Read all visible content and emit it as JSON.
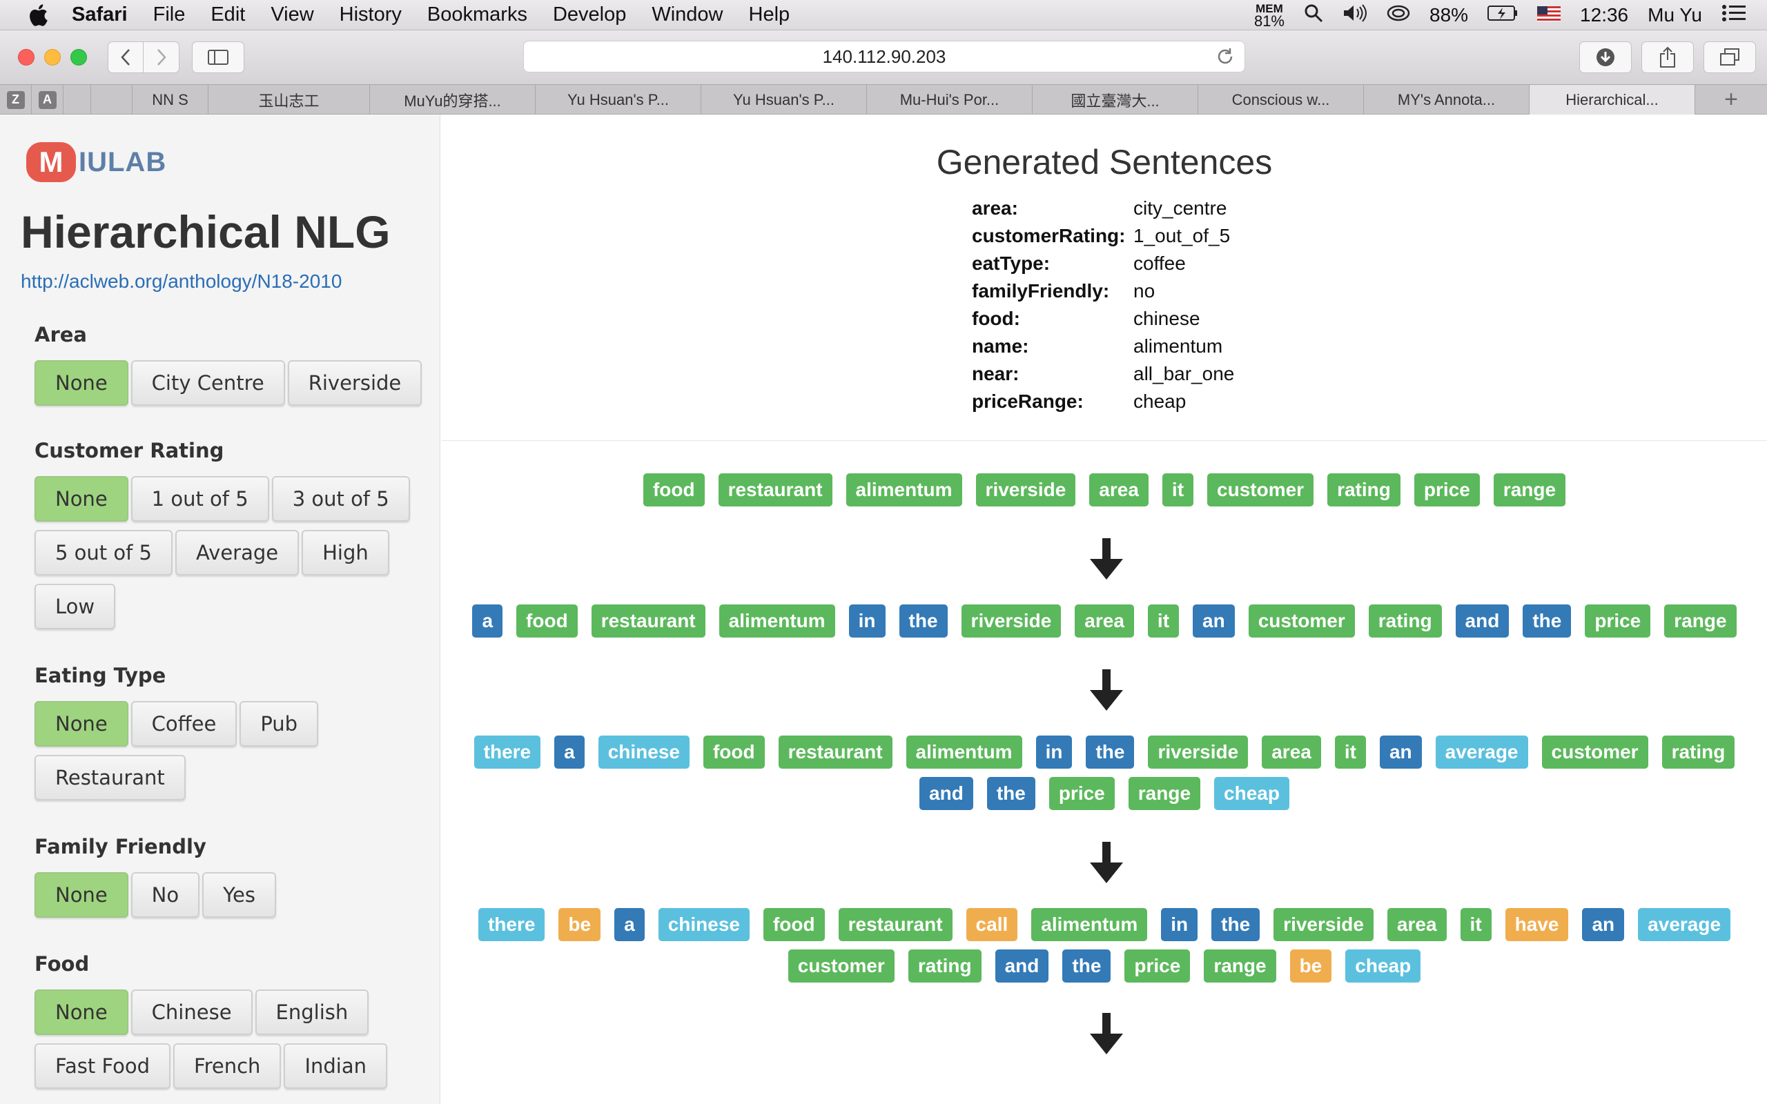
{
  "menubar": {
    "app": "Safari",
    "items": [
      "File",
      "Edit",
      "View",
      "History",
      "Bookmarks",
      "Develop",
      "Window",
      "Help"
    ],
    "mem_label": "MEM",
    "mem_value": "81%",
    "battery": "88%",
    "time": "12:36",
    "user": "Mu Yu"
  },
  "browser": {
    "url": "140.112.90.203",
    "pinned": [
      "Z",
      "A"
    ],
    "tabs": [
      "NN S",
      "玉山志工",
      "MuYu的穿搭...",
      "Yu Hsuan's P...",
      "Yu Hsuan's P...",
      "Mu-Hui's Por...",
      "國立臺灣大...",
      "Conscious w...",
      "MY's Annota...",
      "Hierarchical..."
    ],
    "active_tab": 9
  },
  "sidebar": {
    "logo_m": "M",
    "logo_text": "IULAB",
    "title": "Hierarchical NLG",
    "link": "http://aclweb.org/anthology/N18-2010",
    "groups": [
      {
        "title": "Area",
        "rows": [
          [
            "None",
            "City Centre",
            "Riverside"
          ]
        ],
        "selected": "None"
      },
      {
        "title": "Customer Rating",
        "rows": [
          [
            "None",
            "1 out of 5",
            "3 out of 5"
          ],
          [
            "5 out of 5",
            "Average",
            "High"
          ],
          [
            "Low"
          ]
        ],
        "selected": "None"
      },
      {
        "title": "Eating Type",
        "rows": [
          [
            "None",
            "Coffee",
            "Pub"
          ],
          [
            "Restaurant"
          ]
        ],
        "selected": "None"
      },
      {
        "title": "Family Friendly",
        "rows": [
          [
            "None",
            "No",
            "Yes"
          ]
        ],
        "selected": "None"
      },
      {
        "title": "Food",
        "rows": [
          [
            "None",
            "Chinese",
            "English"
          ],
          [
            "Fast Food",
            "French",
            "Indian"
          ]
        ],
        "selected": "None"
      }
    ]
  },
  "main": {
    "title": "Generated Sentences",
    "attributes": [
      {
        "key": "area:",
        "value": "city_centre"
      },
      {
        "key": "customerRating:",
        "value": "1_out_of_5"
      },
      {
        "key": "eatType:",
        "value": "coffee"
      },
      {
        "key": "familyFriendly:",
        "value": "no"
      },
      {
        "key": "food:",
        "value": "chinese"
      },
      {
        "key": "name:",
        "value": "alimentum"
      },
      {
        "key": "near:",
        "value": "all_bar_one"
      },
      {
        "key": "priceRange:",
        "value": "cheap"
      }
    ],
    "colors": {
      "green": "#5cb85c",
      "blue": "#337ab7",
      "lightblue": "#5bc0de",
      "orange": "#f0ad4e",
      "selected": "#9ed47f"
    },
    "stages": [
      [
        [
          [
            "food",
            "g"
          ],
          [
            "restaurant",
            "g"
          ],
          [
            "alimentum",
            "g"
          ],
          [
            "riverside",
            "g"
          ],
          [
            "area",
            "g"
          ],
          [
            "it",
            "g"
          ],
          [
            "customer",
            "g"
          ],
          [
            "rating",
            "g"
          ],
          [
            "price",
            "g"
          ],
          [
            "range",
            "g"
          ]
        ]
      ],
      [
        [
          [
            "a",
            "b"
          ],
          [
            "food",
            "g"
          ],
          [
            "restaurant",
            "g"
          ],
          [
            "alimentum",
            "g"
          ],
          [
            "in",
            "b"
          ],
          [
            "the",
            "b"
          ],
          [
            "riverside",
            "g"
          ],
          [
            "area",
            "g"
          ],
          [
            "it",
            "g"
          ],
          [
            "an",
            "b"
          ],
          [
            "customer",
            "g"
          ],
          [
            "rating",
            "g"
          ],
          [
            "and",
            "b"
          ],
          [
            "the",
            "b"
          ],
          [
            "price",
            "g"
          ],
          [
            "range",
            "g"
          ]
        ]
      ],
      [
        [
          [
            "there",
            "l"
          ],
          [
            "a",
            "b"
          ],
          [
            "chinese",
            "l"
          ],
          [
            "food",
            "g"
          ],
          [
            "restaurant",
            "g"
          ],
          [
            "alimentum",
            "g"
          ],
          [
            "in",
            "b"
          ],
          [
            "the",
            "b"
          ],
          [
            "riverside",
            "g"
          ],
          [
            "area",
            "g"
          ],
          [
            "it",
            "g"
          ],
          [
            "an",
            "b"
          ],
          [
            "average",
            "l"
          ],
          [
            "customer",
            "g"
          ],
          [
            "rating",
            "g"
          ]
        ],
        [
          [
            "and",
            "b"
          ],
          [
            "the",
            "b"
          ],
          [
            "price",
            "g"
          ],
          [
            "range",
            "g"
          ],
          [
            "cheap",
            "l"
          ]
        ]
      ],
      [
        [
          [
            "there",
            "l"
          ],
          [
            "be",
            "o"
          ],
          [
            "a",
            "b"
          ],
          [
            "chinese",
            "l"
          ],
          [
            "food",
            "g"
          ],
          [
            "restaurant",
            "g"
          ],
          [
            "call",
            "o"
          ],
          [
            "alimentum",
            "g"
          ],
          [
            "in",
            "b"
          ],
          [
            "the",
            "b"
          ],
          [
            "riverside",
            "g"
          ],
          [
            "area",
            "g"
          ],
          [
            "it",
            "g"
          ],
          [
            "have",
            "o"
          ],
          [
            "an",
            "b"
          ],
          [
            "average",
            "l"
          ]
        ],
        [
          [
            "customer",
            "g"
          ],
          [
            "rating",
            "g"
          ],
          [
            "and",
            "b"
          ],
          [
            "the",
            "b"
          ],
          [
            "price",
            "g"
          ],
          [
            "range",
            "g"
          ],
          [
            "be",
            "o"
          ],
          [
            "cheap",
            "l"
          ]
        ]
      ]
    ]
  }
}
